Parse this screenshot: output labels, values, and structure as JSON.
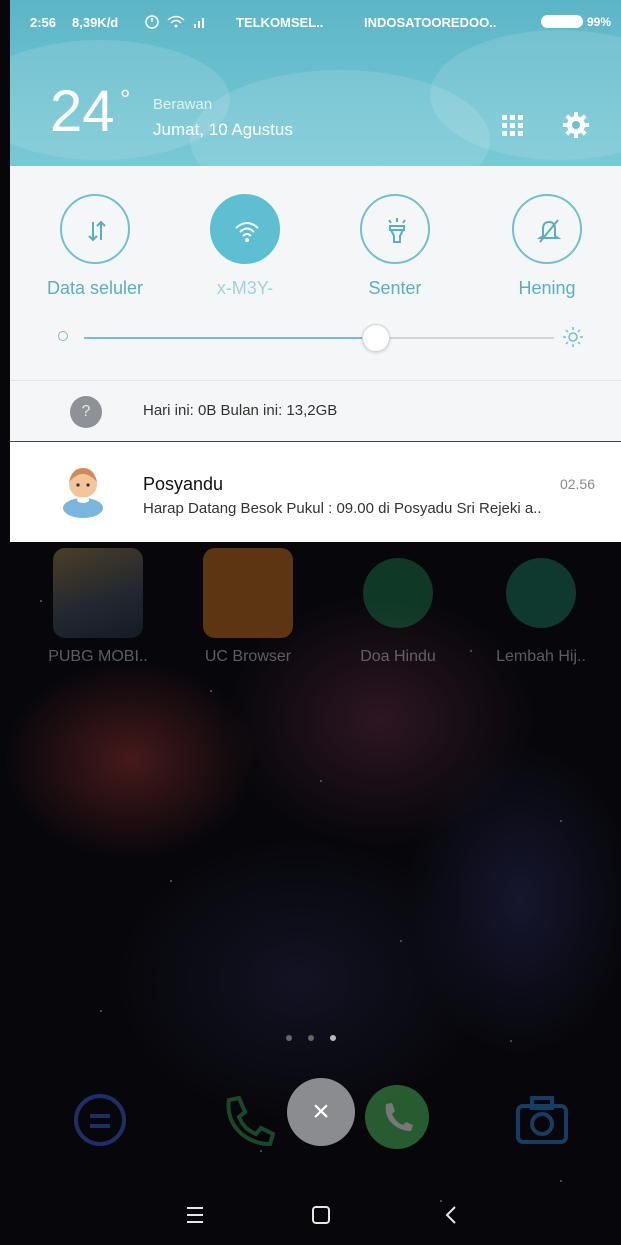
{
  "status_bar": {
    "time": "2:56",
    "speed": "8,39K/d",
    "carrier1": "TELKOMSEL..",
    "carrier2": "INDOSATOOREDOO..",
    "battery_pct": "99%"
  },
  "weather": {
    "temperature": "24",
    "degree_symbol": "°",
    "condition": "Berawan",
    "date": "Jumat, 10 Agustus"
  },
  "quick_settings": {
    "toggles": [
      {
        "label": "Data seluler",
        "icon": "mobile-data-icon",
        "on": false
      },
      {
        "label": "x-M3Y-",
        "icon": "wifi-icon",
        "on": true
      },
      {
        "label": "Senter",
        "icon": "flashlight-icon",
        "on": false
      },
      {
        "label": "Hening",
        "icon": "silent-bell-icon",
        "on": false
      }
    ],
    "brightness_level": 0.63
  },
  "data_usage": {
    "text": "Hari ini: 0B  Bulan ini: 13,2GB",
    "icon_glyph": "?"
  },
  "notification": {
    "app_icon": "baby-icon",
    "title": "Posyandu",
    "time": "02.56",
    "body": "Harap Datang Besok Pukul : 09.00 di Posyadu Sri Rejeki a.."
  },
  "home_apps": [
    {
      "label": "PUBG MOBI.."
    },
    {
      "label": "UC Browser"
    },
    {
      "label": "Doa Hindu"
    },
    {
      "label": "Lembah Hij.."
    }
  ],
  "close_button_glyph": "×",
  "colors": {
    "accent": "#5dbfd1",
    "header": "#6cc1d0"
  }
}
